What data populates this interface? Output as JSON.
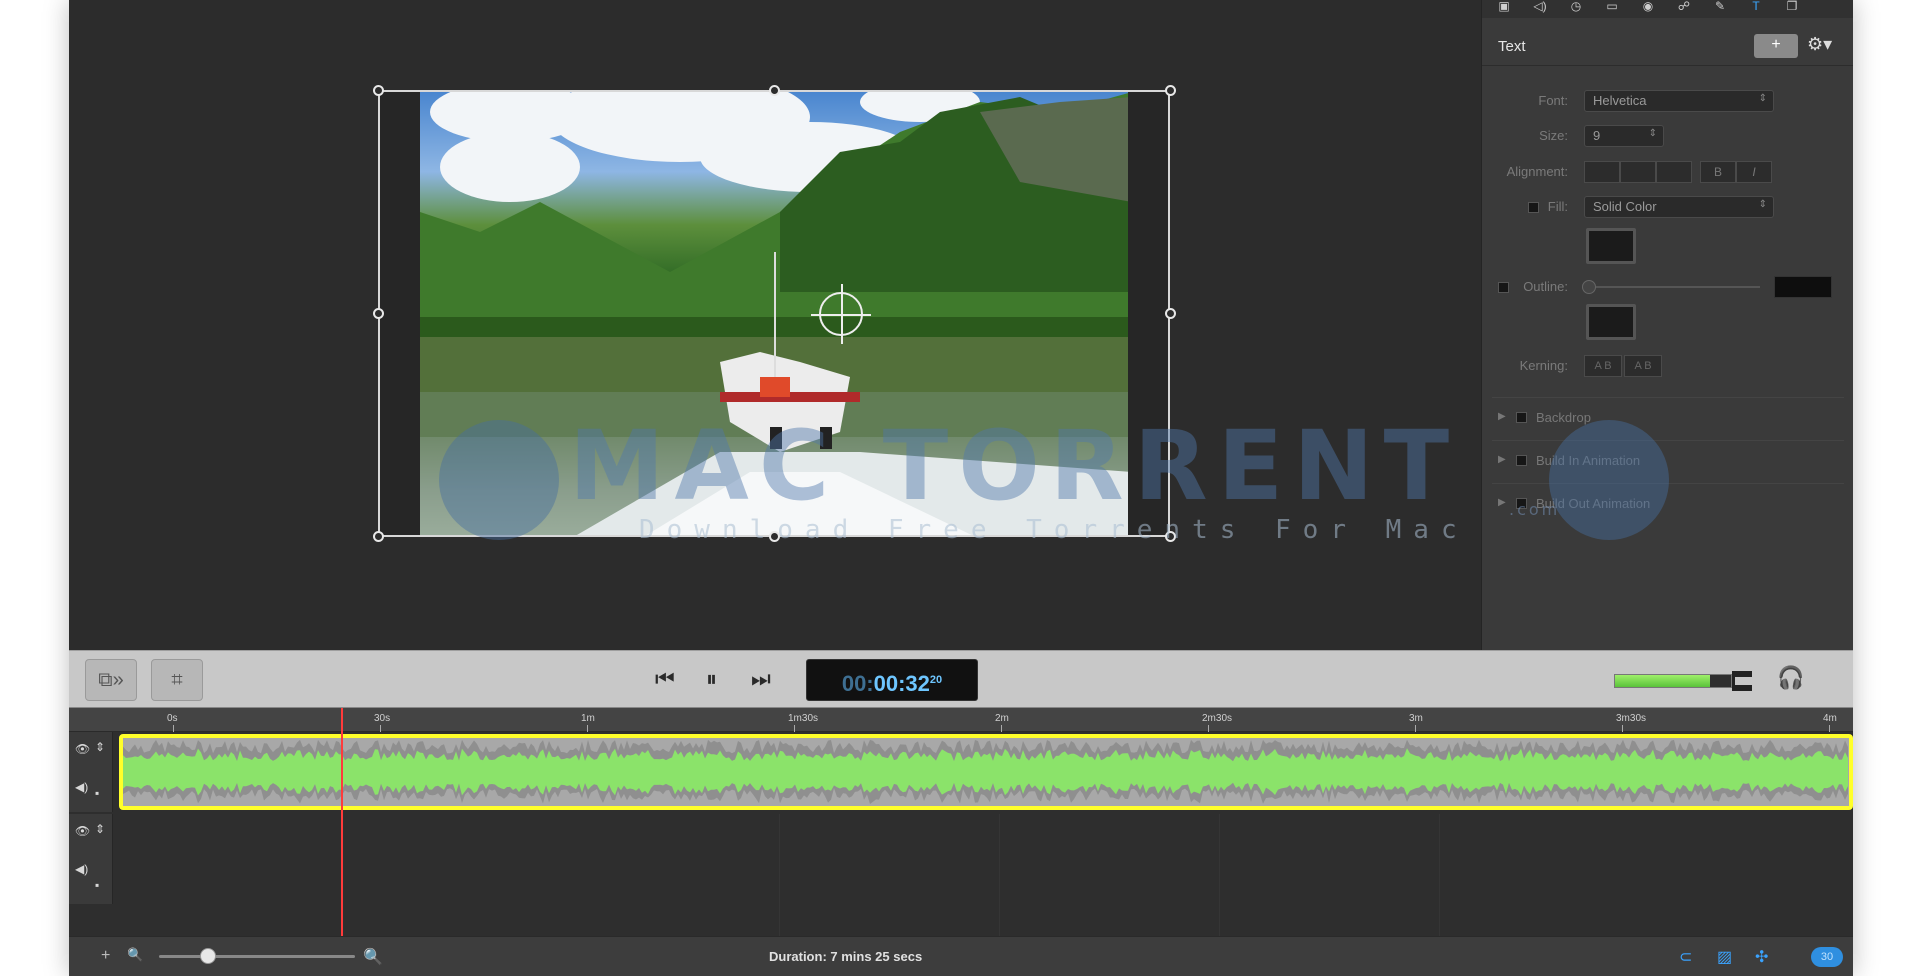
{
  "inspector": {
    "title": "Text",
    "add_label": "+",
    "font_label": "Font:",
    "font_value": "Helvetica",
    "size_label": "Size:",
    "size_value": "9",
    "alignment_label": "Alignment:",
    "bold_label": "B",
    "italic_label": "I",
    "fill_label": "Fill:",
    "fill_value": "Solid Color",
    "outline_label": "Outline:",
    "kerning_label": "Kerning:",
    "kerning_a": "A B",
    "kerning_b": "A B",
    "sections": [
      "Backdrop",
      "Build In Animation",
      "Build Out Animation"
    ]
  },
  "transport": {
    "timecode_dim": "00:",
    "timecode_main": "00:32",
    "timecode_frames": "20",
    "meter_level": 0.82
  },
  "timeline": {
    "ruler_labels": [
      "0s",
      "30s",
      "1m",
      "1m30s",
      "2m",
      "2m30s",
      "3m",
      "3m30s",
      "4m"
    ]
  },
  "status": {
    "duration": "Duration: 7 mins 25 secs",
    "zoom_level": 0.25,
    "badge": "30"
  },
  "watermark": {
    "title": "MAC TORRENT",
    "com": ".com",
    "subtitle": "Download Free Torrents For Mac"
  },
  "colors": {
    "selection": "#ffff2a",
    "waveform_green": "#8be36a",
    "waveform_gray": "#8f8f8f",
    "playhead": "#ff3b3b",
    "accent": "#2f8fe0"
  }
}
